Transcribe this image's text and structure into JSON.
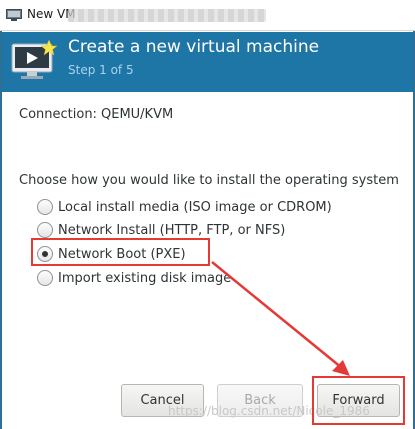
{
  "window": {
    "title": "New VM",
    "app_icon": "virt-manager-icon"
  },
  "banner": {
    "title": "Create a new virtual machine",
    "step": "Step 1 of 5",
    "background_color": "#1e76a7",
    "icon": "vm-monitor-icon"
  },
  "connection": {
    "label": "Connection:",
    "value": "QEMU/KVM"
  },
  "install": {
    "prompt": "Choose how you would like to install the operating system",
    "options": [
      {
        "label": "Local install media (ISO image or CDROM)",
        "selected": false
      },
      {
        "label": "Network Install (HTTP, FTP, or NFS)",
        "selected": false
      },
      {
        "label": "Network Boot (PXE)",
        "selected": true
      },
      {
        "label": "Import existing disk image",
        "selected": false
      }
    ]
  },
  "buttons": {
    "cancel": "Cancel",
    "back": "Back",
    "forward": "Forward"
  },
  "annotation": {
    "color": "#e53935",
    "watermark": "https://blog.csdn.net/Nicole_1986"
  }
}
